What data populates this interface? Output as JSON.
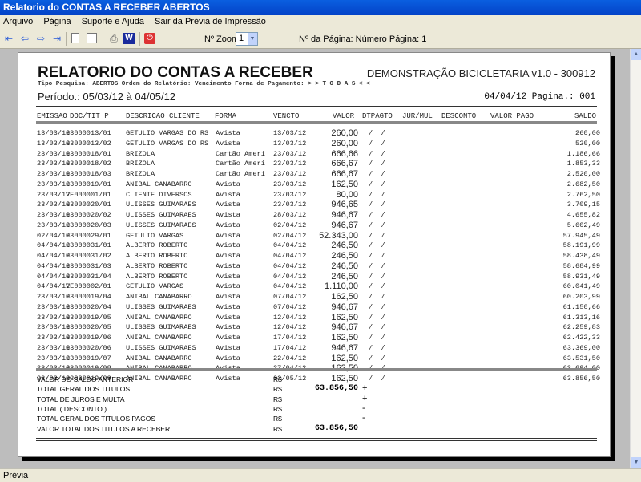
{
  "window": {
    "title": "Relatorio do CONTAS A RECEBER ABERTOS"
  },
  "menu": [
    "Arquivo",
    "Página",
    "Suporte e Ajuda",
    "Sair da Prévia de Impressão"
  ],
  "toolbar": {
    "zoom_label": "Nº Zoom",
    "zoom_value": "1",
    "page_label": "Nº da Página: Número Página: 1"
  },
  "report": {
    "title": "RELATORIO DO CONTAS A RECEBER",
    "company": "DEMONSTRAÇÃO BICICLETARIA v1.0 - 300912",
    "subtitle": "Tipo Pesquisa: ABERTOS   Ordem do Relatório: Vencimento   Forma de Pagamento: > > T O D A S < <",
    "periodo": "Período.: 05/03/12 à 04/05/12",
    "date_page": "04/04/12   Pagina.: 001",
    "columns": [
      "EMISSAO",
      "DOC/TIT P",
      "DESCRICAO CLIENTE",
      "FORMA",
      "VENCTO",
      "VALOR",
      "DTPAGTO",
      "JUR/MUL",
      "DESCONTO",
      "VALOR PAGO",
      "SALDO"
    ],
    "rows": [
      [
        "13/03/12",
        "03000013/01",
        "GETULIO VARGAS DO RS",
        "Avista",
        "13/03/12",
        "260,00",
        "/  /",
        "260,00"
      ],
      [
        "13/03/12",
        "03000013/02",
        "GETULIO VARGAS DO RS",
        "Avista",
        "13/03/12",
        "260,00",
        "/  /",
        "520,00"
      ],
      [
        "23/03/12",
        "03000018/01",
        "BRIZOLA",
        "Cartão Ameri",
        "23/03/12",
        "666,66",
        "/  /",
        "1.186,66"
      ],
      [
        "23/03/12",
        "03000018/02",
        "BRIZOLA",
        "Cartão Ameri",
        "23/03/12",
        "666,67",
        "/  /",
        "1.853,33"
      ],
      [
        "23/03/12",
        "03000018/03",
        "BRIZOLA",
        "Cartão Ameri",
        "23/03/12",
        "666,67",
        "/  /",
        "2.520,00"
      ],
      [
        "23/03/12",
        "03000019/01",
        "ANIBAL CANABARRO",
        "Avista",
        "23/03/12",
        "162,50",
        "/  /",
        "2.682,50"
      ],
      [
        "23/03/12",
        "VE000001/01",
        "CLIENTE DIVERSOS",
        "Avista",
        "23/03/12",
        "80,00",
        "/  /",
        "2.762,50"
      ],
      [
        "23/03/12",
        "03000020/01",
        "ULISSES GUIMARAES",
        "Avista",
        "23/03/12",
        "946,65",
        "/  /",
        "3.709,15"
      ],
      [
        "23/03/12",
        "03000020/02",
        "ULISSES GUIMARAES",
        "Avista",
        "28/03/12",
        "946,67",
        "/  /",
        "4.655,82"
      ],
      [
        "23/03/12",
        "03000020/03",
        "ULISSES GUIMARAES",
        "Avista",
        "02/04/12",
        "946,67",
        "/  /",
        "5.602,49"
      ],
      [
        "02/04/12",
        "03000029/01",
        "GETULIO VARGAS",
        "Avista",
        "02/04/12",
        "52.343,00",
        "/  /",
        "57.945,49"
      ],
      [
        "04/04/12",
        "03000031/01",
        "ALBERTO ROBERTO",
        "Avista",
        "04/04/12",
        "246,50",
        "/  /",
        "58.191,99"
      ],
      [
        "04/04/12",
        "03000031/02",
        "ALBERTO ROBERTO",
        "Avista",
        "04/04/12",
        "246,50",
        "/  /",
        "58.438,49"
      ],
      [
        "04/04/12",
        "03000031/03",
        "ALBERTO ROBERTO",
        "Avista",
        "04/04/12",
        "246,50",
        "/  /",
        "58.684,99"
      ],
      [
        "04/04/12",
        "03000031/04",
        "ALBERTO ROBERTO",
        "Avista",
        "04/04/12",
        "246,50",
        "/  /",
        "58.931,49"
      ],
      [
        "04/04/12",
        "VE000002/01",
        "GETULIO VARGAS",
        "Avista",
        "04/04/12",
        "1.110,00",
        "/  /",
        "60.041,49"
      ],
      [
        "23/03/12",
        "03000019/04",
        "ANIBAL CANABARRO",
        "Avista",
        "07/04/12",
        "162,50",
        "/  /",
        "60.203,99"
      ],
      [
        "23/03/12",
        "03000020/04",
        "ULISSES GUIMARAES",
        "Avista",
        "07/04/12",
        "946,67",
        "/  /",
        "61.150,66"
      ],
      [
        "23/03/12",
        "03000019/05",
        "ANIBAL CANABARRO",
        "Avista",
        "12/04/12",
        "162,50",
        "/  /",
        "61.313,16"
      ],
      [
        "23/03/12",
        "03000020/05",
        "ULISSES GUIMARAES",
        "Avista",
        "12/04/12",
        "946,67",
        "/  /",
        "62.259,83"
      ],
      [
        "23/03/12",
        "03000019/06",
        "ANIBAL CANABARRO",
        "Avista",
        "17/04/12",
        "162,50",
        "/  /",
        "62.422,33"
      ],
      [
        "23/03/12",
        "03000020/06",
        "ULISSES GUIMARAES",
        "Avista",
        "17/04/12",
        "946,67",
        "/  /",
        "63.369,00"
      ],
      [
        "23/03/12",
        "03000019/07",
        "ANIBAL CANABARRO",
        "Avista",
        "22/04/12",
        "162,50",
        "/  /",
        "63.531,50"
      ],
      [
        "23/03/12",
        "03000019/08",
        "ANIBAL CANABARRO",
        "Avista",
        "27/04/12",
        "162,50",
        "/  /",
        "63.694,00"
      ],
      [
        "23/03/12",
        "03000019/09",
        "ANIBAL CANABARRO",
        "Avista",
        "02/05/12",
        "162,50",
        "/  /",
        "63.856,50"
      ]
    ],
    "totals": [
      {
        "label": "VALOR DO SALDO ANTERIOR",
        "cur": "R$",
        "value": "",
        "sign": ""
      },
      {
        "label": "TOTAL GERAL DOS TITULOS",
        "cur": "R$",
        "value": "63.856,50",
        "sign": "+"
      },
      {
        "label": "TOTAL DE JUROS E MULTA",
        "cur": "R$",
        "value": "",
        "sign": "+"
      },
      {
        "label": "TOTAL ( DESCONTO )",
        "cur": "R$",
        "value": "",
        "sign": "-"
      },
      {
        "label": "TOTAL GERAL DOS TITULOS PAGOS",
        "cur": "R$",
        "value": "",
        "sign": "-"
      },
      {
        "label": "VALOR TOTAL DOS TITULOS A RECEBER",
        "cur": "R$",
        "value": "63.856,50",
        "sign": ""
      }
    ]
  },
  "status": "Prévia"
}
